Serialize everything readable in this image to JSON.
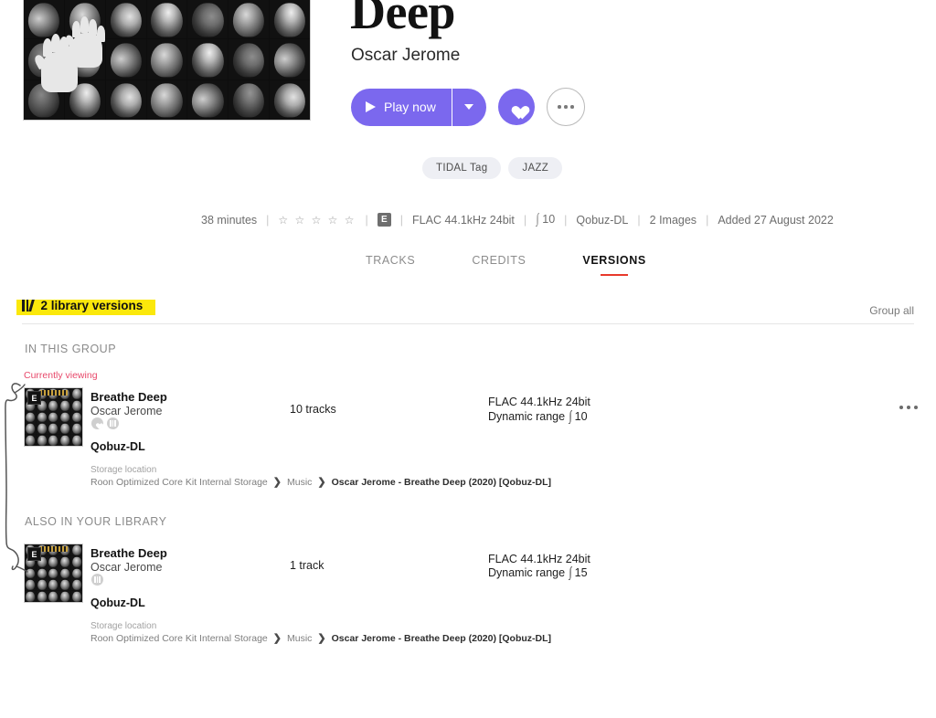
{
  "album": {
    "title": "Deep",
    "artist": "Oscar Jerome",
    "cover_alt": "breathe-deep-contact-sheet"
  },
  "actions": {
    "play_label": "Play now",
    "play_icon": "play-triangle-icon",
    "dropdown_icon": "chevron-down-icon",
    "favorite_icon": "heart-icon",
    "more_icon": "ellipsis-icon"
  },
  "tags": [
    {
      "label": "TIDAL Tag"
    },
    {
      "label": "JAZZ"
    }
  ],
  "meta": {
    "duration": "38 minutes",
    "stars": "☆ ☆ ☆ ☆ ☆",
    "explicit": "E",
    "format": "FLAC 44.1kHz 24bit",
    "dynamic_range_glyph": "∫",
    "dynamic_range": "10",
    "source": "Qobuz-DL",
    "images": "2 Images",
    "added": "Added 27 August 2022"
  },
  "tabs": [
    {
      "label": "TRACKS",
      "active": false
    },
    {
      "label": "CREDITS",
      "active": false
    },
    {
      "label": "VERSIONS",
      "active": true
    }
  ],
  "versions_header": {
    "icon": "bar-chart-icon",
    "label": "2 library versions",
    "group_all": "Group all"
  },
  "sections": [
    {
      "heading": "IN THIS GROUP",
      "status": "Currently viewing",
      "row": {
        "title": "Breathe Deep",
        "artist": "Oscar Jerome",
        "badges": [
          "heart-icon",
          "bar-chart-icon"
        ],
        "source": "Qobuz-DL",
        "explicit": "E",
        "tracks": "10 tracks",
        "format": "FLAC 44.1kHz 24bit",
        "dr_label": "Dynamic range",
        "dr_glyph": "∫",
        "dr_value": "10",
        "more_icon": "ellipsis-icon",
        "storage_label": "Storage location",
        "storage_root": "Roon Optimized Core Kit Internal Storage",
        "storage_mid": "Music",
        "storage_leaf": "Oscar Jerome - Breathe Deep (2020) [Qobuz-DL]"
      }
    },
    {
      "heading": "ALSO IN YOUR LIBRARY",
      "status": "",
      "row": {
        "title": "Breathe Deep",
        "artist": "Oscar Jerome",
        "badges": [
          "bar-chart-icon"
        ],
        "source": "Qobuz-DL",
        "explicit": "E",
        "tracks": "1 track",
        "format": "FLAC 44.1kHz 24bit",
        "dr_label": "Dynamic range",
        "dr_glyph": "∫",
        "dr_value": "15",
        "more_icon": "",
        "storage_label": "Storage location",
        "storage_root": "Roon Optimized Core Kit Internal Storage",
        "storage_mid": "Music",
        "storage_leaf": "Oscar Jerome - Breathe Deep (2020) [Qobuz-DL]"
      }
    }
  ],
  "colors": {
    "accent_purple": "#7b68ee",
    "tab_underline_red": "#e8392b",
    "highlight_yellow": "#fbe80b",
    "currently_viewing_pink": "#e8486a"
  }
}
